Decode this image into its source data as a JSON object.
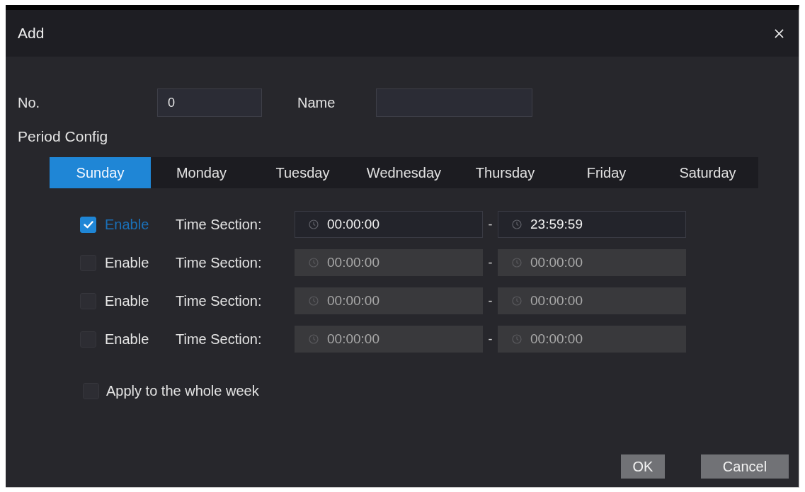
{
  "dialog": {
    "title": "Add"
  },
  "fields": [
    {
      "label": "No.",
      "value": "0"
    },
    {
      "label": "Name"
    }
  ],
  "period_config": {
    "label": "Period Config",
    "tabs": [
      {
        "label": "Sunday",
        "selected": true
      },
      {
        "label": "Monday",
        "selected": false
      },
      {
        "label": "Tuesday",
        "selected": false
      },
      {
        "label": "Wednesday",
        "selected": false
      },
      {
        "label": "Thursday",
        "selected": false
      },
      {
        "label": "Friday",
        "selected": false
      },
      {
        "label": "Saturday",
        "selected": false
      }
    ],
    "sections": [
      {
        "checked": true,
        "enable_label": "Enable",
        "time_label": "Time Section:",
        "start": "00:00:00",
        "separator": "-",
        "end": "23:59:59"
      },
      {
        "checked": false,
        "enable_label": "Enable",
        "time_label": "Time Section:",
        "start": "00:00:00",
        "separator": "-",
        "end": "00:00:00"
      },
      {
        "checked": false,
        "enable_label": "Enable",
        "time_label": "Time Section:",
        "start": "00:00:00",
        "separator": "-",
        "end": "00:00:00"
      },
      {
        "checked": false,
        "enable_label": "Enable",
        "time_label": "Time Section:",
        "start": "00:00:00",
        "separator": "-",
        "end": "00:00:00"
      }
    ]
  },
  "apply_whole_week": {
    "label": "Apply to the whole week",
    "checked": false
  },
  "buttons": [
    "OK",
    "Cancel"
  ]
}
